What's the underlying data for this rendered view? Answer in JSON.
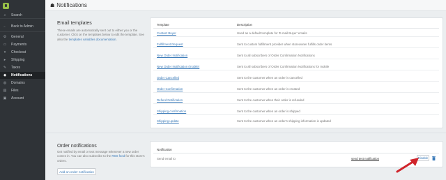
{
  "sidebar": {
    "search": "Search",
    "back": "Back to Admin",
    "items": [
      {
        "label": "General",
        "icon": "gear-icon",
        "glyph": "⚙"
      },
      {
        "label": "Payments",
        "icon": "card-icon",
        "glyph": "▭"
      },
      {
        "label": "Checkout",
        "icon": "cart-icon",
        "glyph": "🛒"
      },
      {
        "label": "Shipping",
        "icon": "truck-icon",
        "glyph": "⛟"
      },
      {
        "label": "Taxes",
        "icon": "tag-icon",
        "glyph": "✎"
      },
      {
        "label": "Notifications",
        "icon": "bell-icon",
        "glyph": "🔔",
        "active": true
      },
      {
        "label": "Domains",
        "icon": "globe-icon",
        "glyph": "◍"
      },
      {
        "label": "Files",
        "icon": "folder-icon",
        "glyph": "▤"
      },
      {
        "label": "Account",
        "icon": "user-icon",
        "glyph": "▣"
      }
    ]
  },
  "header": {
    "title": "Notifications"
  },
  "email_templates": {
    "title": "Email templates",
    "desc_main": "These emails are automatically sent out to either you or the customer. Click on the templates below to edit the template. See also the",
    "desc_link": "templates variables documentation",
    "desc_tail": ".",
    "col_template": "Template",
    "col_description": "Description",
    "rows": [
      {
        "template": "Contact Buyer",
        "description": "Used as a default template for 'E-mail Buyer' emails"
      },
      {
        "template": "Fulfillment Request",
        "description": "Sent to custom fulfillment provider when storeowner fulfills order items"
      },
      {
        "template": "New Order Notification",
        "description": "Sent to all subscribers of Order Confirmation Notifications"
      },
      {
        "template": "New Order Notification (mobile)",
        "description": "Sent to all subscribers of Order Confirmation Notifications for mobile"
      },
      {
        "template": "Order Cancelled",
        "description": "Sent to the customer when an order is cancelled"
      },
      {
        "template": "Order Confirmation",
        "description": "Sent to the customer when an order is created"
      },
      {
        "template": "Refund Notification",
        "description": "Sent to the customer when their order is refunded"
      },
      {
        "template": "Shipping confirmation",
        "description": "Sent to the customer when an order is shipped"
      },
      {
        "template": "Shipping update",
        "description": "Sent to the customer when an order's shipping information is updated"
      }
    ]
  },
  "order_notifications": {
    "title": "Order notifications",
    "desc_main": "Get notified by email or text message whenever a new order comes in. You can also subscribe to the",
    "desc_link": "RSS feed",
    "desc_tail": "for this store's orders.",
    "add_button": "Add an order notification",
    "col_notification": "Notification",
    "row_label": "Send email to",
    "send_test": "send test notification",
    "disable": "Disable"
  },
  "colors": {
    "accent": "#3a7ab8",
    "sidebar": "#2f3337",
    "arrow": "#d0242b"
  }
}
